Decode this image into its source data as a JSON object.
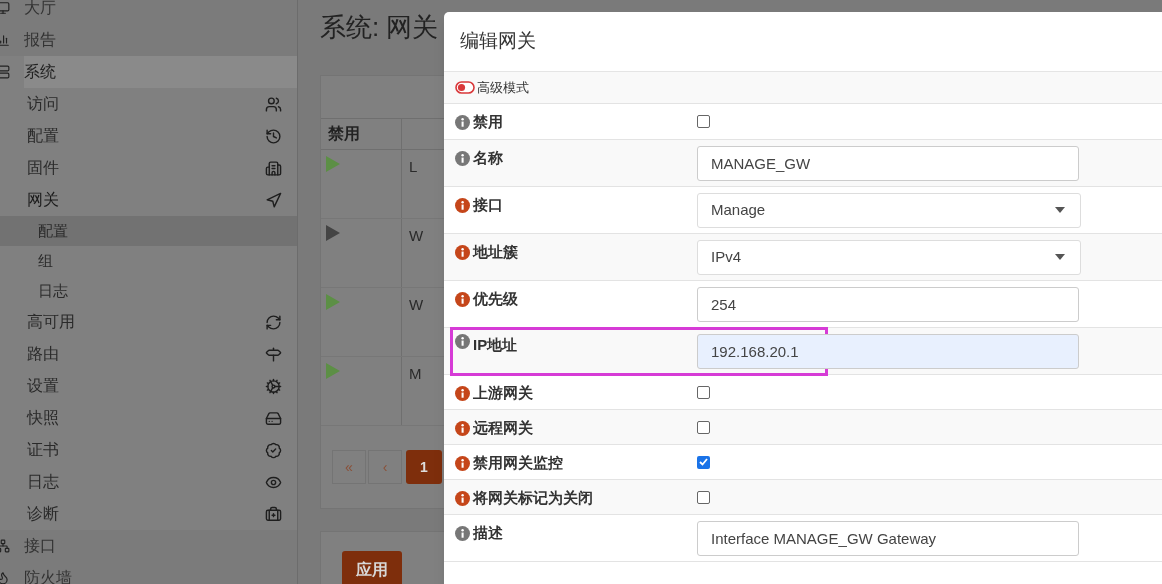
{
  "sidebar": {
    "items": [
      {
        "label": "大厅"
      },
      {
        "label": "报告"
      },
      {
        "label": "系统",
        "expanded": true,
        "children": [
          {
            "label": "访问"
          },
          {
            "label": "配置"
          },
          {
            "label": "固件"
          },
          {
            "label": "网关",
            "expanded": true,
            "children": [
              {
                "label": "配置",
                "selected": true
              },
              {
                "label": "组",
                "selected": false
              },
              {
                "label": "日志",
                "selected": false
              }
            ]
          },
          {
            "label": "高可用"
          },
          {
            "label": "路由"
          },
          {
            "label": "设置"
          },
          {
            "label": "快照"
          },
          {
            "label": "证书"
          },
          {
            "label": "日志"
          },
          {
            "label": "诊断"
          }
        ]
      },
      {
        "label": "接口"
      },
      {
        "label": "防火墙"
      }
    ]
  },
  "page": {
    "title": "系统: 网关",
    "table": {
      "columns": [
        "禁用"
      ],
      "rows": [
        {
          "color": "#5c8f45",
          "text": "L"
        },
        {
          "color": "#444444",
          "text": "W"
        },
        {
          "color": "#5c8f45",
          "text": "W"
        },
        {
          "color": "#5c8f45",
          "text": "M"
        }
      ]
    },
    "pagination": [
      {
        "label": "«",
        "selected": false
      },
      {
        "label": "‹",
        "selected": false
      },
      {
        "label": "1",
        "selected": true
      }
    ],
    "apply_button": "应用"
  },
  "dialog": {
    "title": "编辑网关",
    "advanced_mode": {
      "label": "高级模式",
      "on": false
    },
    "fields": [
      {
        "kind": "checkbox",
        "label": "禁用",
        "required": false,
        "marked": false,
        "checked": false
      },
      {
        "kind": "text",
        "label": "名称",
        "required": false,
        "marked": false,
        "value": "MANAGE_GW",
        "autofilled": false
      },
      {
        "kind": "select",
        "label": "接口",
        "required": true,
        "marked": false,
        "value": "Manage"
      },
      {
        "kind": "select",
        "label": "地址簇",
        "required": true,
        "marked": false,
        "value": "IPv4"
      },
      {
        "kind": "text",
        "label": "优先级",
        "required": true,
        "marked": false,
        "value": "254",
        "autofilled": false
      },
      {
        "kind": "text",
        "label": "IP地址",
        "required": false,
        "marked": true,
        "value": "192.168.20.1",
        "autofilled": true
      },
      {
        "kind": "checkbox",
        "label": "上游网关",
        "required": true,
        "marked": false,
        "checked": false
      },
      {
        "kind": "checkbox",
        "label": "远程网关",
        "required": true,
        "marked": false,
        "checked": false
      },
      {
        "kind": "checkbox",
        "label": "禁用网关监控",
        "required": true,
        "marked": false,
        "checked": true
      },
      {
        "kind": "checkbox",
        "label": "将网关标记为关闭",
        "required": true,
        "marked": false,
        "checked": false
      },
      {
        "kind": "text",
        "label": "描述",
        "required": false,
        "marked": false,
        "value": "Interface MANAGE_GW Gateway",
        "autofilled": false
      }
    ]
  }
}
